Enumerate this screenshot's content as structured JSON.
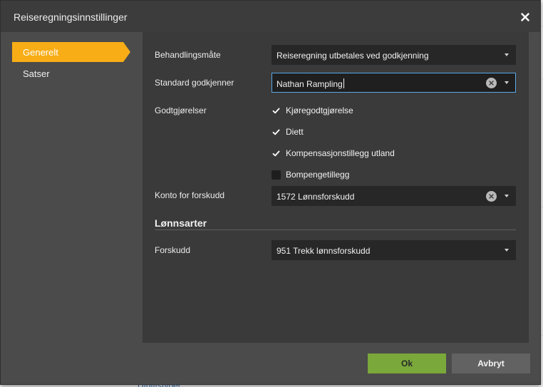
{
  "background": {
    "link_text": "Utgiftstyper"
  },
  "dialog": {
    "title": "Reiseregningsinnstillinger",
    "close_icon": "close-icon"
  },
  "nav": {
    "items": [
      {
        "label": "Generelt",
        "active": true
      },
      {
        "label": "Satser",
        "active": false
      }
    ]
  },
  "form": {
    "behandlingsmate": {
      "label": "Behandlingsmåte",
      "value": "Reiseregning utbetales ved godkjenning"
    },
    "godkjenner": {
      "label": "Standard godkjenner",
      "value": "Nathan Rampling"
    },
    "godtgjorelser": {
      "label": "Godtgjørelser",
      "options": [
        {
          "label": "Kjøregodtgjørelse",
          "checked": true
        },
        {
          "label": "Diett",
          "checked": true
        },
        {
          "label": "Kompensasjonstillegg utland",
          "checked": true
        },
        {
          "label": "Bompengetillegg",
          "checked": false
        }
      ]
    },
    "konto": {
      "label": "Konto for forskudd",
      "value": "1572 Lønnsforskudd"
    }
  },
  "lonnsarter": {
    "title": "Lønnsarter",
    "forskudd": {
      "label": "Forskudd",
      "value": "951 Trekk lønnsforskudd"
    }
  },
  "buttons": {
    "ok": "Ok",
    "cancel": "Avbryt"
  },
  "colors": {
    "accent": "#f8ad17",
    "ok_button": "#7aa83a",
    "focus_border": "#5aa8e6"
  }
}
